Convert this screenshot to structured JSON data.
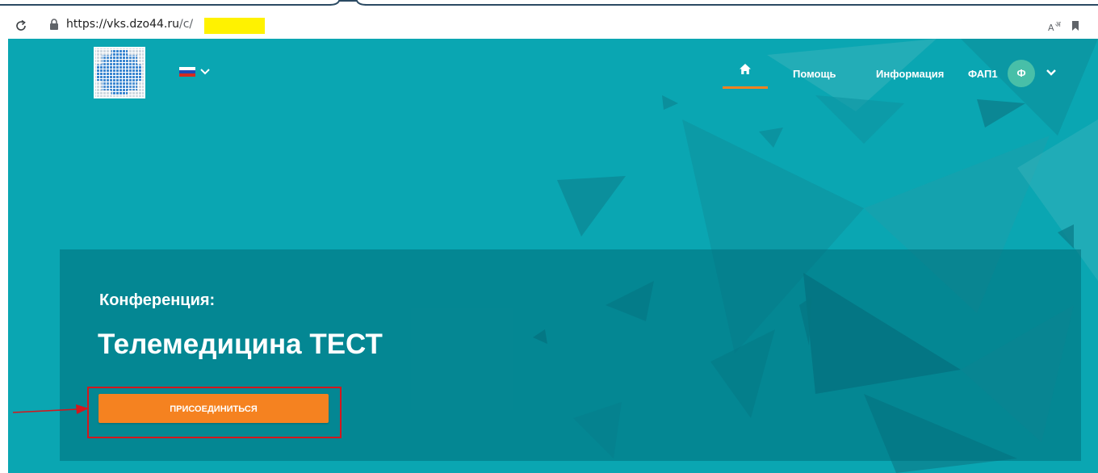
{
  "browser": {
    "url_host": "https://vks.dzo44.ru",
    "url_path": "/c/",
    "icons": {
      "reload": "reload-icon",
      "lock": "lock-icon",
      "translate": "translate-icon",
      "bookmark": "bookmark-icon"
    }
  },
  "header": {
    "logo": "logo-image",
    "language": {
      "flag": "flag-ru-icon",
      "chevron": "chevron-down-icon"
    },
    "nav": {
      "home_icon": "home-icon",
      "help_label": "Помощь",
      "info_label": "Информация",
      "user_label": "ФАП1",
      "avatar_initial": "Ф",
      "user_menu_icon": "chevron-down-icon"
    }
  },
  "conference": {
    "label": "Конференция:",
    "title": "Телемедицина ТЕСТ",
    "join_button_label": "ПРИСОЕДИНИТЬСЯ"
  },
  "colors": {
    "hero_background": "#0aa6b2",
    "panel_background": "#00707a",
    "accent_orange": "#f58220",
    "avatar_green": "#48bfa8",
    "annotation_red": "#d4171d",
    "url_highlight": "#fff200"
  }
}
